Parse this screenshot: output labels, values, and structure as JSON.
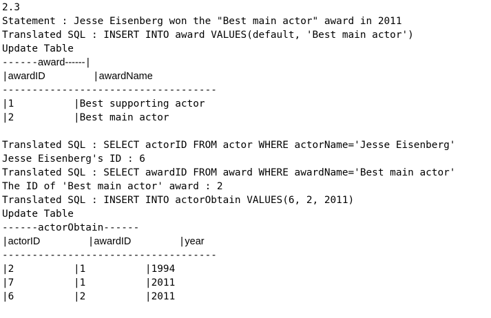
{
  "console": {
    "section": "2.3",
    "statement": "Statement : Jesse Eisenberg won the \"Best main actor\" award in 2011",
    "sql_insert_award": "Translated SQL : INSERT INTO award VALUES(default, 'Best main actor')",
    "update_table_1": "Update Table",
    "award_table": {
      "title_prefix": "------",
      "title": "award",
      "title_suffix": "------",
      "title_cursor": "|",
      "header_bar_1": "|",
      "header_col_1": "awardID",
      "header_gap": "        ",
      "header_bar_2": "|",
      "header_col_2": "awardName",
      "separator": "------------------------------------",
      "rows": [
        "|1          |Best supporting actor",
        "|2          |Best main actor"
      ]
    },
    "blank": "",
    "sql_select_actor": "Translated SQL : SELECT actorID FROM actor WHERE actorName='Jesse Eisenberg'",
    "actor_id_result": "Jesse Eisenberg's ID : 6",
    "sql_select_award": "Translated SQL : SELECT awardID FROM award WHERE awardName='Best main actor'",
    "award_id_result": "The ID of 'Best main actor' award : 2",
    "sql_insert_obtain": "Translated SQL : INSERT INTO actorObtain VALUES(6, 2, 2011)",
    "update_table_2": "Update Table",
    "obtain_table": {
      "title": "------actorObtain------",
      "header_bar_1": "|",
      "header_col_1": "actorID",
      "header_gap_1": "        ",
      "header_bar_2": "|",
      "header_col_2": "awardID",
      "header_gap_2": "        ",
      "header_bar_3": "|",
      "header_col_3": "year",
      "separator": "------------------------------------",
      "rows": [
        "|2          |1          |1994",
        "|7          |1          |2011",
        "|6          |2          |2011"
      ]
    }
  }
}
